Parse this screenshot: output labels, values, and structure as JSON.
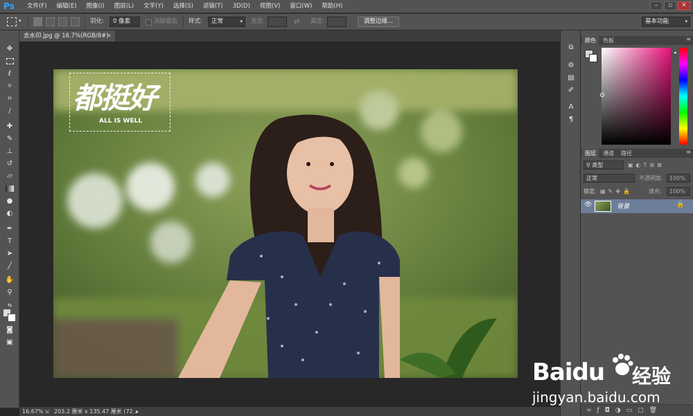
{
  "app": {
    "logo": "Ps"
  },
  "menu": [
    "文件(F)",
    "编辑(E)",
    "图像(I)",
    "图层(L)",
    "文字(Y)",
    "选择(S)",
    "滤镜(T)",
    "3D(D)",
    "视图(V)",
    "窗口(W)",
    "帮助(H)"
  ],
  "options": {
    "feather_label": "羽化:",
    "feather_value": "0 像素",
    "antialias_label": "消除锯齿",
    "style_label": "样式:",
    "style_value": "正常",
    "width_label": "宽度:",
    "height_label": "高度:",
    "refine_edge": "调整边缘...",
    "workspace": "基本功能"
  },
  "document": {
    "tab_title": "去水印.jpg @ 16.7%(RGB/8#)"
  },
  "image_overlay": {
    "logo_text": "都挺好",
    "tagline": "ALL IS WELL"
  },
  "status": {
    "zoom": "16.67%",
    "doc_size": "203.2 厘米 x 135.47 厘米 (72..."
  },
  "panels": {
    "color_tabs": [
      "颜色",
      "色板"
    ],
    "layers_tabs": [
      "图层",
      "通道",
      "路径"
    ],
    "kind_filter": "类型",
    "blend_mode": "正常",
    "opacity_label": "不透明度:",
    "opacity_value": "100%",
    "lock_label": "锁定:",
    "fill_label": "填充:",
    "fill_value": "100%",
    "layer_name": "背景"
  },
  "watermark": {
    "brand": "Baidu",
    "brand_cn": "经验",
    "url": "jingyan.baidu.com"
  },
  "colors": {
    "accent": "#31a8ff",
    "layer_selected": "#6d7e99",
    "panel_bg": "#535353"
  }
}
